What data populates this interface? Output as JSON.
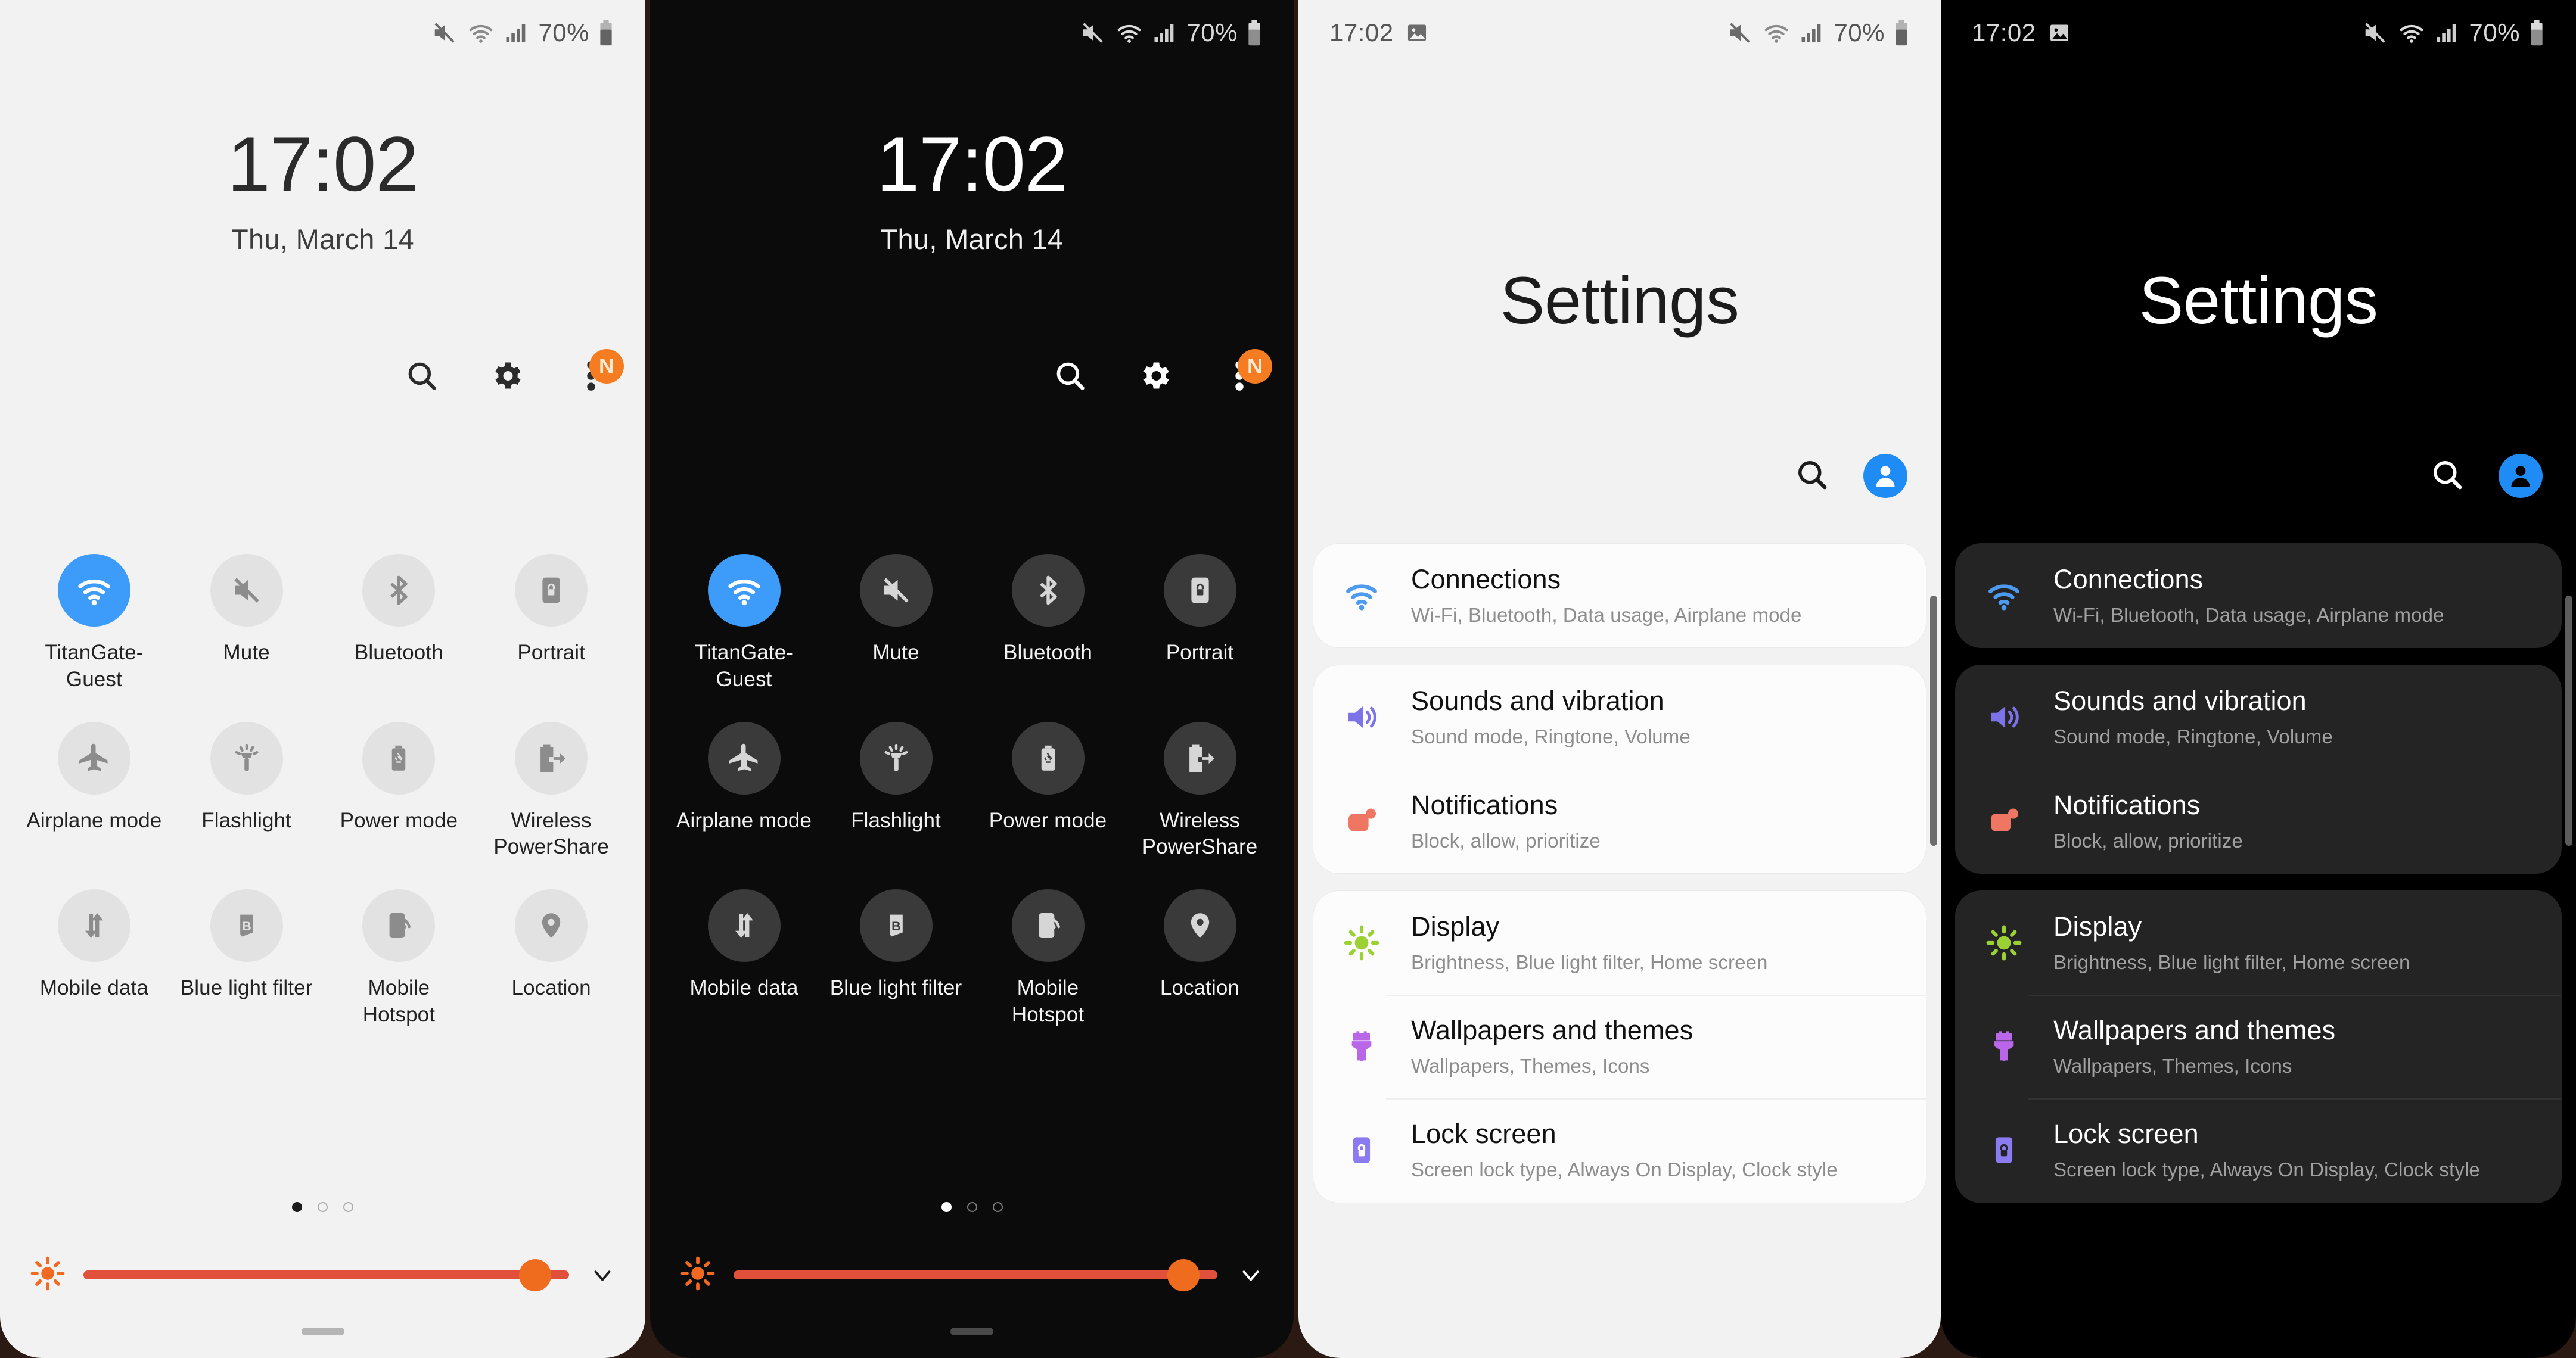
{
  "status_bar": {
    "time": "17:02",
    "battery_percent": "70%",
    "icons": [
      "gallery-icon",
      "mute-icon",
      "wifi-icon",
      "signal-icon",
      "battery-icon"
    ]
  },
  "quick_settings": {
    "clock_time": "17:02",
    "clock_date": "Thu, March 14",
    "actions": [
      {
        "name": "search-icon",
        "label": "Search"
      },
      {
        "name": "gear-icon",
        "label": "Settings"
      },
      {
        "name": "more-options-icon",
        "label": "More options",
        "badge": "N"
      }
    ],
    "tiles": [
      {
        "label": "TitanGate-Guest",
        "icon": "wifi-icon",
        "active": true
      },
      {
        "label": "Mute",
        "icon": "mute-icon",
        "active": false
      },
      {
        "label": "Bluetooth",
        "icon": "bluetooth-icon",
        "active": false
      },
      {
        "label": "Portrait",
        "icon": "screen-rotation-lock-icon",
        "active": false
      },
      {
        "label": "Airplane mode",
        "icon": "airplane-icon",
        "active": false
      },
      {
        "label": "Flashlight",
        "icon": "flashlight-icon",
        "active": false
      },
      {
        "label": "Power mode",
        "icon": "battery-power-mode-icon",
        "active": false
      },
      {
        "label": "Wireless PowerShare",
        "icon": "wireless-powershare-icon",
        "active": false
      },
      {
        "label": "Mobile data",
        "icon": "mobile-data-arrows-icon",
        "active": false
      },
      {
        "label": "Blue light filter",
        "icon": "blue-light-filter-icon",
        "active": false
      },
      {
        "label": "Mobile Hotspot",
        "icon": "mobile-hotspot-icon",
        "active": false
      },
      {
        "label": "Location",
        "icon": "location-pin-icon",
        "active": false
      }
    ],
    "page_dots": {
      "count": 3,
      "active_index": 0
    },
    "brightness": {
      "icon": "brightness-sun-icon",
      "value_percent": 93,
      "track_color": "#e0503a",
      "thumb_color": "#ef6c1f",
      "expand_icon": "chevron-down-icon"
    }
  },
  "settings_app": {
    "title": "Settings",
    "actions": [
      {
        "name": "search-icon",
        "label": "Search settings"
      },
      {
        "name": "account-avatar",
        "label": "Samsung account"
      }
    ],
    "groups": [
      {
        "rows": [
          {
            "title": "Connections",
            "subtitle": "Wi-Fi, Bluetooth, Data usage, Airplane mode",
            "icon": "wifi-icon",
            "color": "#4d9bf0"
          }
        ]
      },
      {
        "rows": [
          {
            "title": "Sounds and vibration",
            "subtitle": "Sound mode, Ringtone, Volume",
            "icon": "speaker-icon",
            "color": "#7e72e8"
          },
          {
            "title": "Notifications",
            "subtitle": "Block, allow, prioritize",
            "icon": "notification-icon",
            "color": "#ef7663"
          }
        ]
      },
      {
        "rows": [
          {
            "title": "Display",
            "subtitle": "Brightness, Blue light filter, Home screen",
            "icon": "brightness-sun-icon",
            "color": "#9bd135"
          },
          {
            "title": "Wallpapers and themes",
            "subtitle": "Wallpapers, Themes, Icons",
            "icon": "paint-brush-icon",
            "color": "#b966e8"
          },
          {
            "title": "Lock screen",
            "subtitle": "Screen lock type, Always On Display, Clock style",
            "icon": "lock-icon",
            "color": "#8a7bf0"
          }
        ]
      }
    ]
  },
  "theme_colors": {
    "light_background": "#f2f2f2",
    "dark_background": "#0b0b0b",
    "settings_dark_background": "#000000",
    "accent_blue": "#3d9bfa",
    "badge_orange": "#f57c20",
    "page_backdrop": "#2b1a14"
  }
}
